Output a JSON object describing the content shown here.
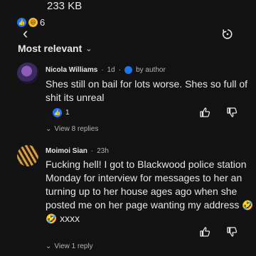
{
  "status": {
    "file_size": "233 KB"
  },
  "reactions_top": {
    "count": "6",
    "types": [
      "like-icon",
      "haha-icon"
    ]
  },
  "header": {
    "sort_label": "Most relevant"
  },
  "comments": [
    {
      "author": "Nicola Williams",
      "time": "1d",
      "author_badge": "by author",
      "text": "Shes still on bail for lots worse. Shes so full of shit its unreal",
      "reaction_count": "1",
      "replies_label": "View 8 replies"
    },
    {
      "author": "Moimoi Sian",
      "time": "23h",
      "text": "Fucking hell! I got to Blackwood police station Monday for interview for messages to her an turning up to her house ages ago when she posted me on her page wanting my address",
      "text_suffix": "xxxx",
      "replies_label": "View 1 reply"
    }
  ],
  "colors": {
    "background": "#121212",
    "text": "#e4e6eb",
    "muted": "#b0b3b8",
    "accent": "#1877f2"
  }
}
